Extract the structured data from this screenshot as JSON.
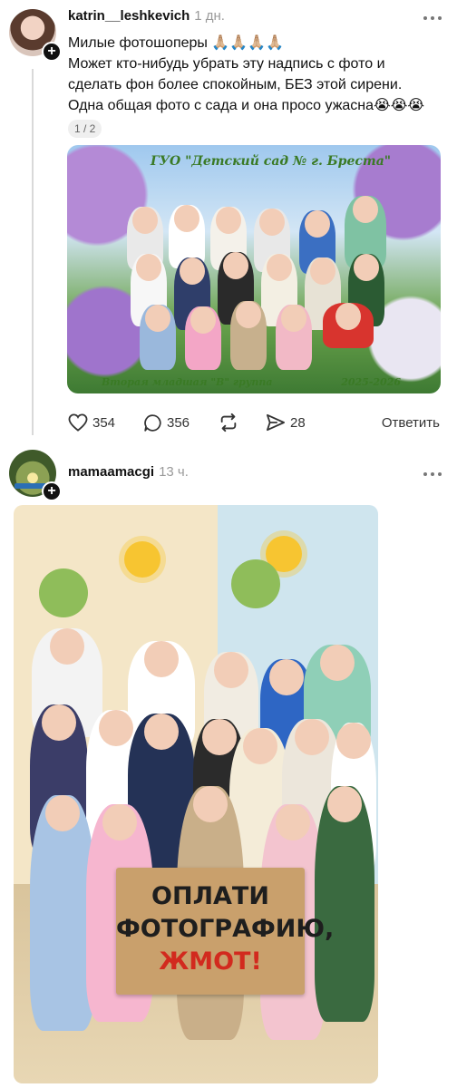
{
  "posts": [
    {
      "username": "katrin__leshkevich",
      "time": "1 дн.",
      "text_lines": [
        "Милые фотошоперы 🙏🏼🙏🏼🙏🏼🙏🏼",
        "Может кто-нибудь убрать эту надпись с фото и",
        "сделать фон более спокойным, БЕЗ этой сирени.",
        "Одна общая фото с сада и она просо ужасна😭😭😭"
      ],
      "page_indicator": "1 / 2",
      "photo": {
        "title": "ГУО \"Детский сад № г. Бреста\"",
        "footer_left": "Вторая младшая \"В\" группа",
        "footer_right": "2025-2026"
      },
      "likes": "354",
      "comments": "356",
      "shares": "28",
      "reply_label": "Ответить"
    },
    {
      "username": "mamaamacgi",
      "time": "13 ч.",
      "photo": {
        "sign_lines": [
          "ОПЛАТИ",
          "ФОТОГРАФИЮ,",
          "ЖМОТ!"
        ]
      }
    }
  ],
  "colors": {
    "text": "#111111",
    "muted": "#9a9a9a",
    "follow_badge": "#111111",
    "sign_red": "#d22a1e"
  },
  "icons": [
    "plus-icon",
    "more-icon",
    "heart-icon",
    "comment-icon",
    "repost-icon",
    "share-icon"
  ]
}
